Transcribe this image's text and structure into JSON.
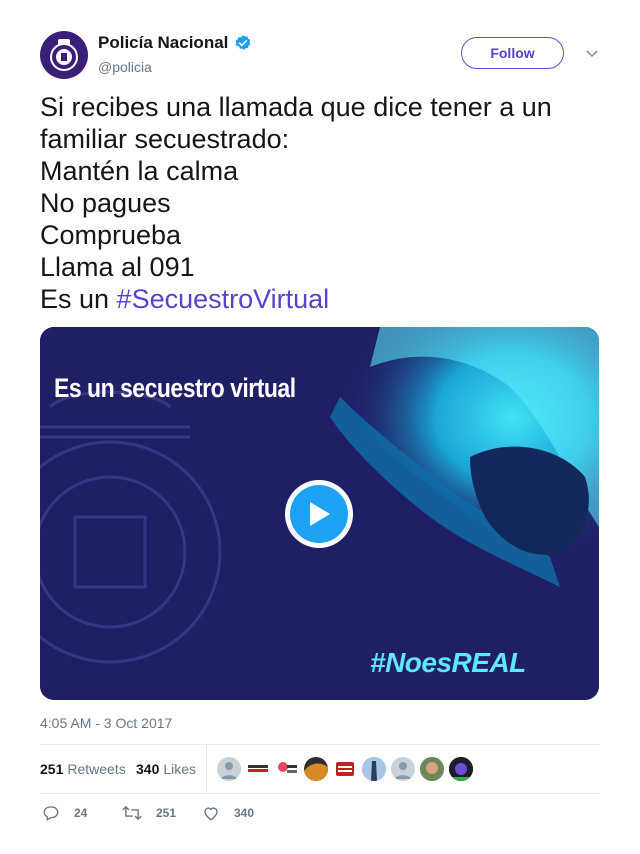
{
  "author": {
    "name": "Policía Nacional",
    "handle": "@policia",
    "verified": true,
    "avatar_color": "#3a1f78"
  },
  "follow_label": "Follow",
  "tweet": {
    "lines": [
      "Si recibes una llamada que dice tener a un",
      "familiar secuestrado:",
      "Mantén la calma",
      "No pagues",
      "Comprueba",
      "Llama al 091"
    ],
    "last_line_prefix": "Es un ",
    "hashtag": "#SecuestroVirtual"
  },
  "media": {
    "title": "Es un secuestro virtual",
    "tag": "#NoesREAL",
    "play_icon": "play-icon"
  },
  "timestamp": "4:05 AM - 3 Oct 2017",
  "stats": {
    "retweets_count": "251",
    "retweets_label": "Retweets",
    "likes_count": "340",
    "likes_label": "Likes"
  },
  "actions": {
    "reply_count": "24",
    "retweet_count": "251",
    "like_count": "340"
  },
  "colors": {
    "accent": "#5b3fd1",
    "twitter_blue": "#1da1f2",
    "muted": "#657786"
  }
}
